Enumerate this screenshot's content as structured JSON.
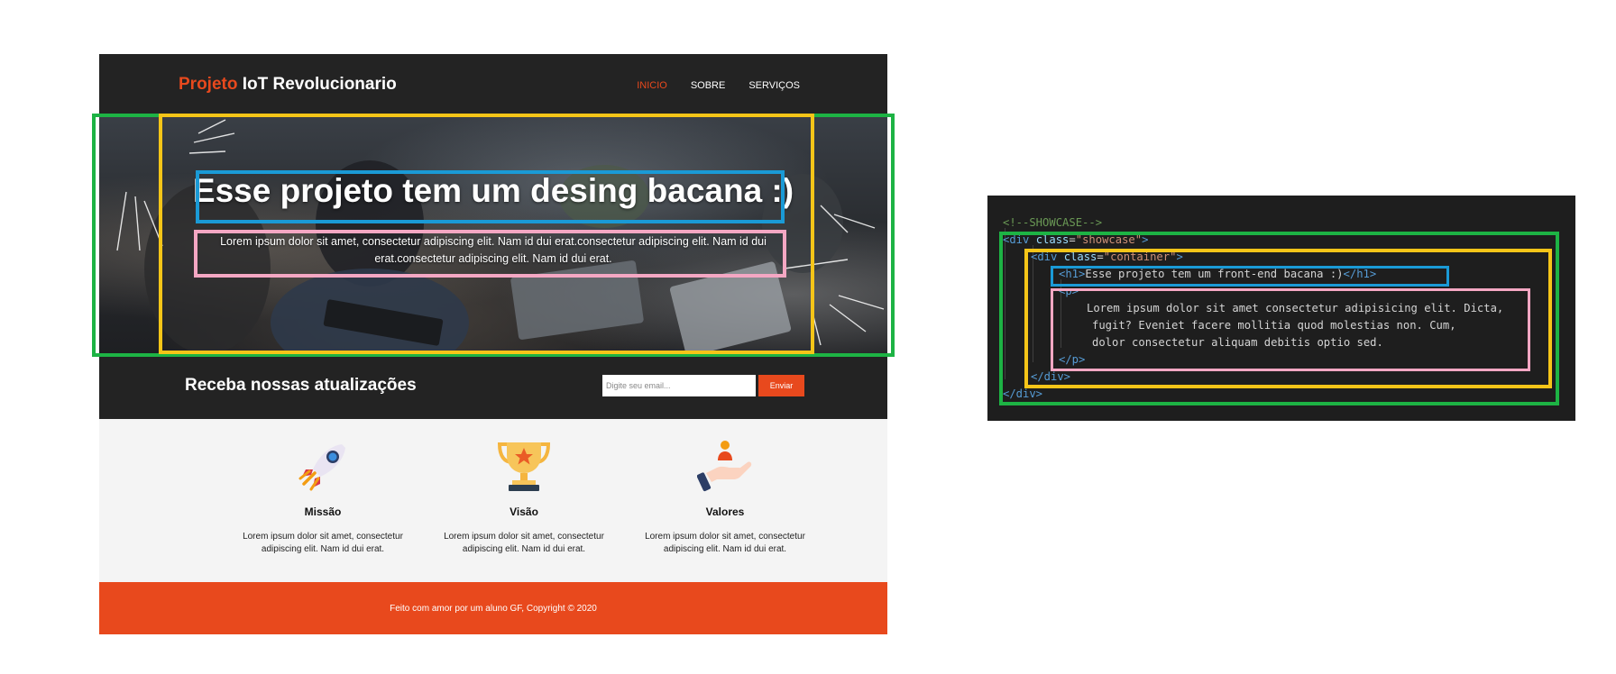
{
  "site": {
    "logo": {
      "accent": "Projeto",
      "rest": " IoT Revolucionario"
    },
    "nav": [
      "INICIO",
      "SOBRE",
      "SERVIÇOS"
    ],
    "showcase": {
      "title": "Esse projeto tem um desing bacana :)",
      "text": "Lorem ipsum dolor sit amet, consectetur adipiscing elit. Nam id dui erat.consectetur adipiscing elit. Nam id dui erat.consectetur adipiscing elit. Nam id dui erat."
    },
    "newsletter": {
      "title": "Receba nossas atualizações",
      "placeholder": "Digite seu email...",
      "button": "Enviar"
    },
    "boxes": [
      {
        "icon": "rocket-icon",
        "title": "Missão",
        "text": "Lorem ipsum dolor sit amet, consectetur adipiscing elit. Nam id dui erat."
      },
      {
        "icon": "trophy-icon",
        "title": "Visão",
        "text": "Lorem ipsum dolor sit amet, consectetur adipiscing elit. Nam id dui erat."
      },
      {
        "icon": "hand-person-icon",
        "title": "Valores",
        "text": "Lorem ipsum dolor sit amet, consectetur adipiscing elit. Nam id dui erat."
      }
    ],
    "footer": "Feito com amor por um aluno GF, Copyright © 2020"
  },
  "code": {
    "comment": "<!--SHOWCASE-->",
    "div_open": "<div",
    "class_attr": "class",
    "eq": "=",
    "showcase_value": "\"showcase\"",
    "container_value": "\"container\"",
    "gt": ">",
    "h1_open": "<h1>",
    "h1_text": "Esse projeto tem um front-end bacana :)",
    "h1_close": "</h1>",
    "p_open": "<p>",
    "p_lines": [
      "Lorem ipsum dolor sit amet consectetur adipisicing elit. Dicta,",
      "fugit? Eveniet facere mollitia quod molestias non. Cum,",
      "dolor consectetur aliquam debitis optio sed."
    ],
    "p_close": "</p>",
    "div_close": "</div>"
  },
  "colors": {
    "accent": "#e8491d",
    "dark": "#232323",
    "light_bg": "#f4f4f4",
    "frame_green": "#1db344",
    "frame_yellow": "#f5c518",
    "frame_blue": "#1a9ad6",
    "frame_pink": "#f4a7c3"
  }
}
